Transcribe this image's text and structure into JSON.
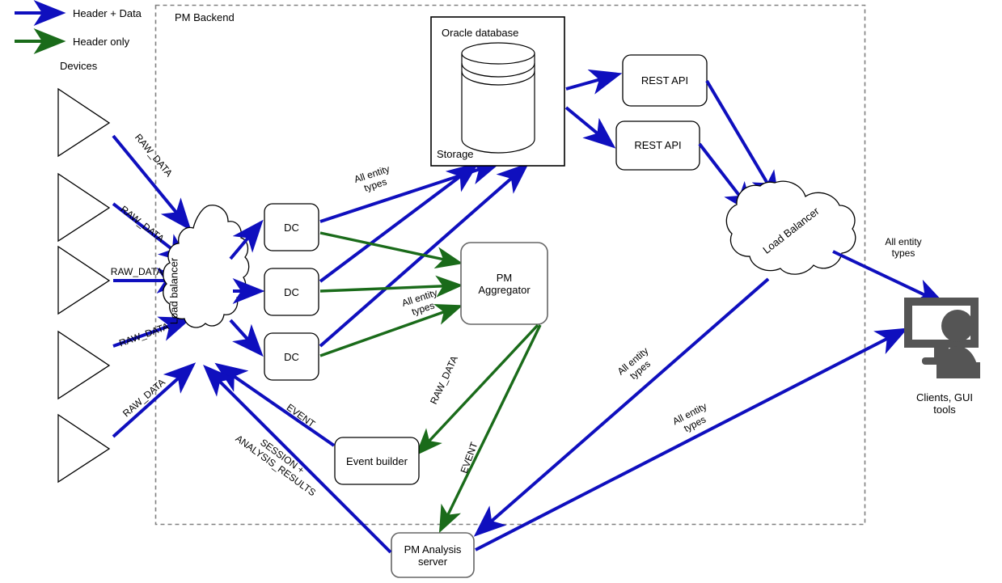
{
  "legend": {
    "items": [
      {
        "label": "Header + Data",
        "color": "#0f0fbe"
      },
      {
        "label": "Header only",
        "color": "#1a6b1a"
      }
    ],
    "devices_label": "Devices"
  },
  "boundary": {
    "label": "PM Backend"
  },
  "nodes": {
    "load_balancer_left": "Load balancer",
    "dc1": "DC",
    "dc2": "DC",
    "dc3": "DC",
    "storage_title": "Oracle database",
    "storage_footer": "Storage",
    "rest_api_1": "REST API",
    "rest_api_2": "REST API",
    "load_balancer_right": "Load Balancer",
    "pm_aggregator": "PM\nAggregator",
    "event_builder": "Event builder",
    "pm_analysis_server": "PM Analysis\nserver",
    "clients": "Clients, GUI tools"
  },
  "edge_labels": {
    "raw_data_1": "RAW_DATA",
    "raw_data_2": "RAW_DATA",
    "raw_data_3": "RAW_DATA",
    "raw_data_4": "RAW_DATA",
    "raw_data_5": "RAW_DATA",
    "all_entity_types_storage": "All entity\ntypes",
    "all_entity_types_aggregator": "All entity\ntypes",
    "all_entity_types_clients": "All entity\ntypes",
    "all_entity_types_lb_analysis": "All entity\ntypes",
    "all_entity_types_lb_clients": "All entity\ntypes",
    "raw_data_aggregator_event_builder": "RAW_DATA",
    "event_aggregator_analysis": "EVENT",
    "event_builder_to_lb": "EVENT",
    "session_analysis_results": "SESSION +\nANALYSIS_RESULTS"
  },
  "colors": {
    "blue": "#0f0fbe",
    "green": "#1a6b1a",
    "node_stroke": "#000000",
    "node_stroke_gray": "#666666",
    "boundary_stroke": "#808080",
    "icon_fill": "#555555"
  }
}
